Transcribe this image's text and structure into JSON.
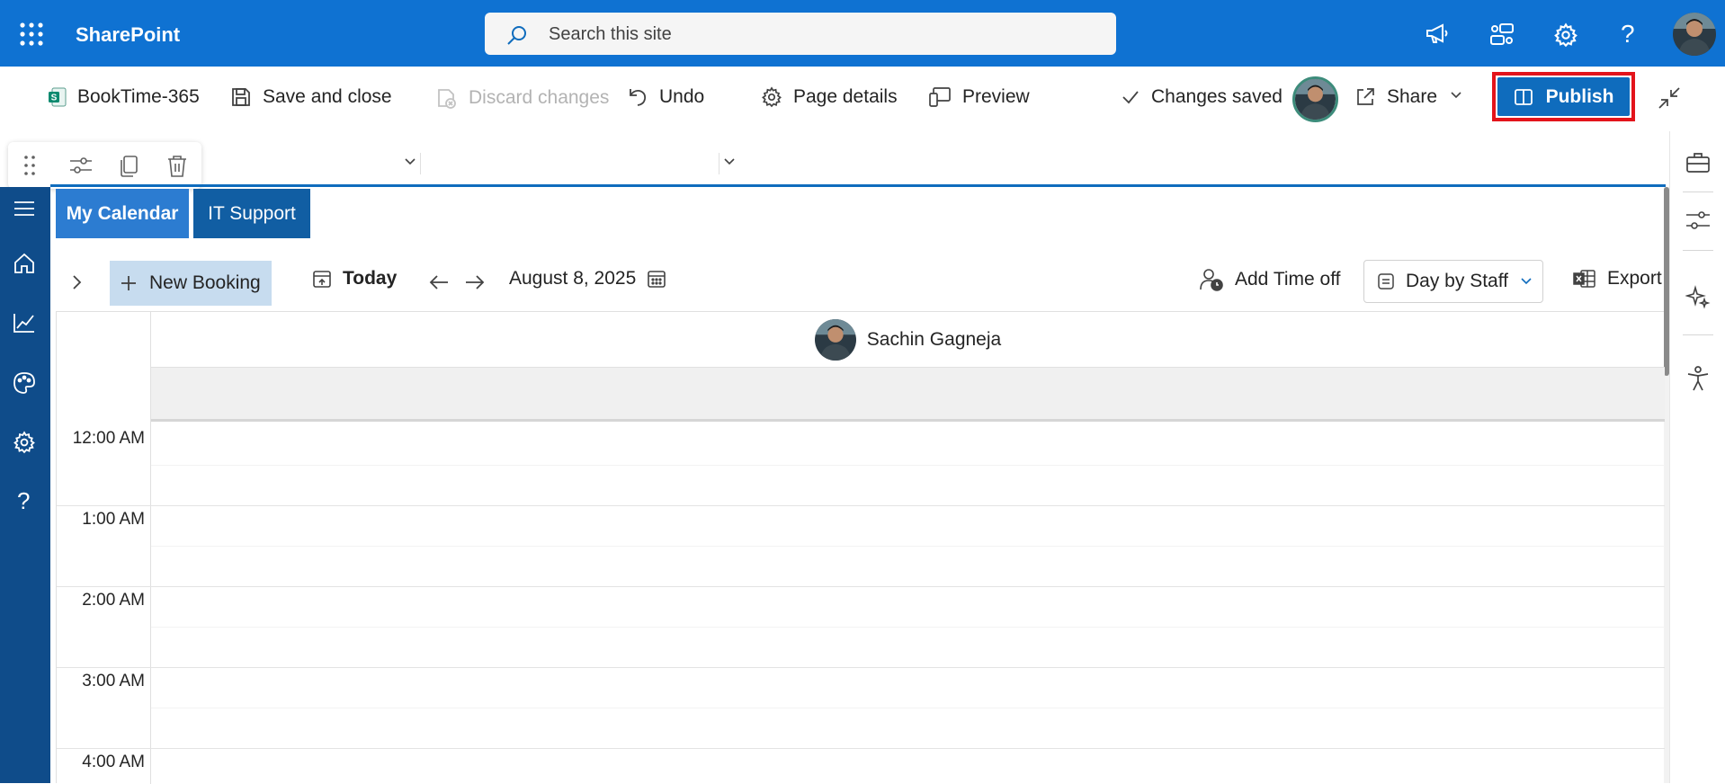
{
  "suitebar": {
    "brand": "SharePoint",
    "search_placeholder": "Search this site",
    "icons": [
      "app-launcher-icon",
      "megaphone-icon",
      "connections-icon",
      "gear-icon",
      "help-icon"
    ],
    "bg_color": "#0f72d2"
  },
  "commandbar": {
    "page_name": "BookTime-365",
    "save_close": "Save and close",
    "discard": "Discard changes",
    "undo": "Undo",
    "page_details": "Page details",
    "preview": "Preview",
    "status": "Changes saved",
    "share": "Share",
    "publish": "Publish",
    "publish_color": "#0f6cbd",
    "highlight_color": "#e3141b"
  },
  "tabs": [
    {
      "label": "My Calendar",
      "selected": true
    },
    {
      "label": "IT Support",
      "selected": false
    }
  ],
  "calendar_toolbar": {
    "new_booking": "New Booking",
    "today": "Today",
    "date": "August 8, 2025",
    "add_time_off": "Add Time off",
    "view": "Day by Staff",
    "export": "Export"
  },
  "staff": {
    "name": "Sachin Gagneja"
  },
  "hours": [
    "12:00 AM",
    "1:00 AM",
    "2:00 AM",
    "3:00 AM",
    "4:00 AM"
  ],
  "leftnav": {
    "icons": [
      "menu-icon",
      "home-icon",
      "analytics-icon",
      "palette-icon",
      "settings-icon",
      "help-icon"
    ]
  },
  "rightrail": {
    "icons": [
      "toolbox-icon",
      "settings-sliders-icon",
      "sparkle-icon",
      "accessibility-icon"
    ]
  }
}
